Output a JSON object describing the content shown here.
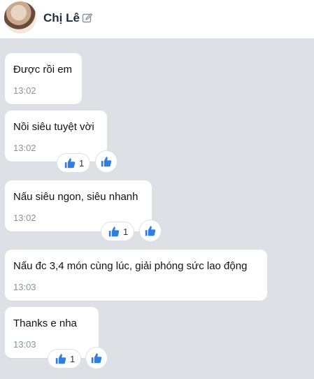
{
  "header": {
    "name": "Chị Lê"
  },
  "messages": [
    {
      "text": "Được rồi em",
      "time": "13:02"
    },
    {
      "text": "Nồi siêu tuyệt vời",
      "time": "13:02",
      "reactions": "1"
    },
    {
      "text": "Nấu siêu ngon, siêu nhanh",
      "time": "13:02",
      "reactions": "1"
    },
    {
      "text": "Nấu đc 3,4 món cùng lúc, giải phóng sức lao động",
      "time": "13:03"
    },
    {
      "text": "Thanks e nha",
      "time": "13:03",
      "reactions": "1"
    }
  ],
  "colors": {
    "background": "#dde1e6",
    "bubble": "#ffffff",
    "like": "#2f7fe0"
  },
  "icons": {
    "edit": "edit-icon",
    "like": "thumbs-up-icon"
  }
}
